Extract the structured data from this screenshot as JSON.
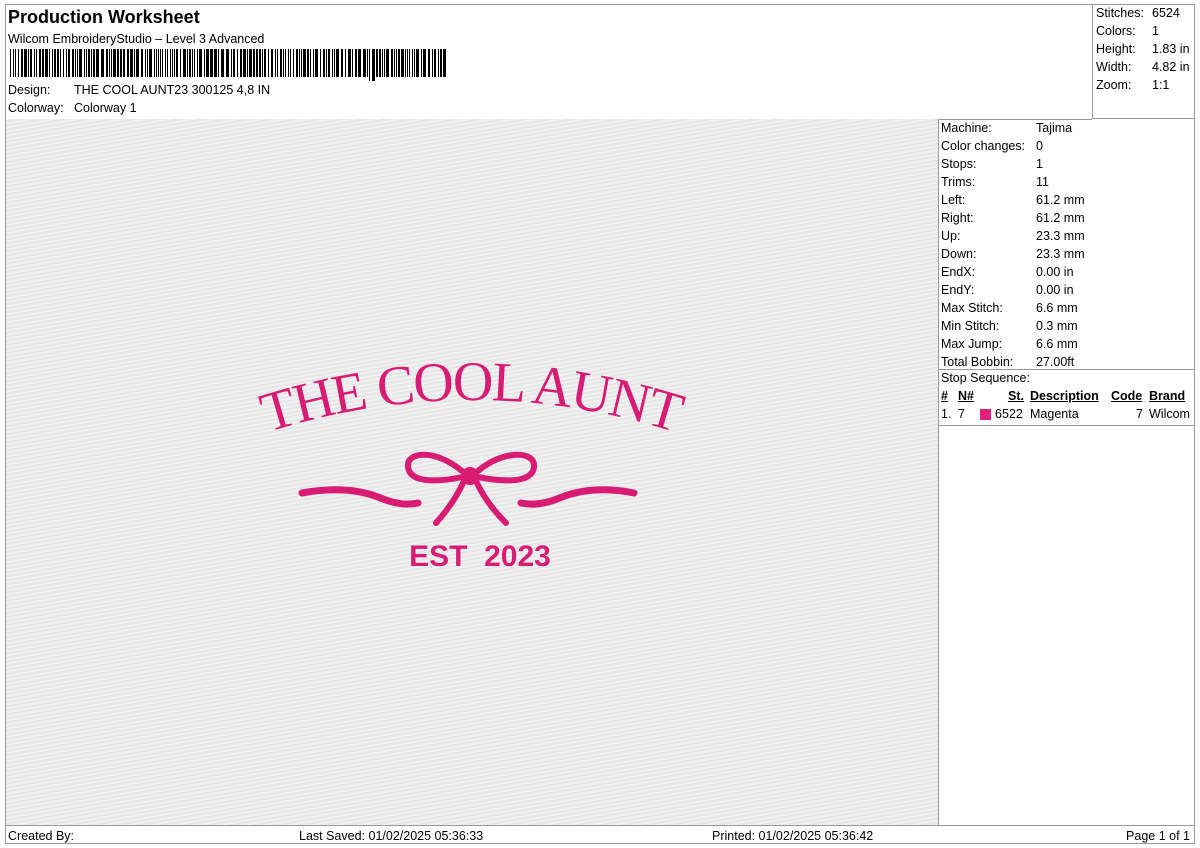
{
  "header": {
    "title": "Production Worksheet",
    "subtitle": "Wilcom EmbroideryStudio – Level 3 Advanced",
    "design_label": "Design:",
    "design_value": "THE COOL AUNT23 300125 4,8 IN",
    "colorway_label": "Colorway:",
    "colorway_value": "Colorway 1"
  },
  "stats": {
    "stitches_label": "Stitches:",
    "stitches": "6524",
    "colors_label": "Colors:",
    "colors": "1",
    "height_label": "Height:",
    "height": "1.83 in",
    "width_label": "Width:",
    "width": "4.82 in",
    "zoom_label": "Zoom:",
    "zoom": "1:1"
  },
  "machine": [
    {
      "label": "Machine:",
      "value": "Tajima"
    },
    {
      "label": "Color changes:",
      "value": "0"
    },
    {
      "label": "Stops:",
      "value": "1"
    },
    {
      "label": "Trims:",
      "value": "11"
    },
    {
      "label": "Left:",
      "value": "61.2 mm"
    },
    {
      "label": "Right:",
      "value": "61.2 mm"
    },
    {
      "label": "Up:",
      "value": "23.3 mm"
    },
    {
      "label": "Down:",
      "value": "23.3 mm"
    },
    {
      "label": "EndX:",
      "value": "0.00 in"
    },
    {
      "label": "EndY:",
      "value": "0.00 in"
    },
    {
      "label": "Max Stitch:",
      "value": "6.6 mm"
    },
    {
      "label": "Min Stitch:",
      "value": "0.3 mm"
    },
    {
      "label": "Max Jump:",
      "value": "6.6 mm"
    },
    {
      "label": "Total Bobbin:",
      "value": "27.00ft"
    }
  ],
  "stop_sequence": {
    "title": "Stop Sequence:",
    "headers": {
      "num": "#",
      "needle": "N#",
      "stitches": "St.",
      "description": "Description",
      "code": "Code",
      "brand": "Brand"
    },
    "rows": [
      {
        "num": "1.",
        "needle": "7",
        "color": "#e0207a",
        "stitches": "6522",
        "description": "Magenta",
        "code": "7",
        "brand": "Wilcom"
      }
    ]
  },
  "design": {
    "line1": "THE COOL AUNT",
    "line2": "EST  2023",
    "thread_color": "#d81b73"
  },
  "footer": {
    "created_by": "Created By:",
    "last_saved": "Last Saved: 01/02/2025 05:36:33",
    "printed": "Printed: 01/02/2025 05:36:42",
    "page": "Page 1 of 1"
  }
}
